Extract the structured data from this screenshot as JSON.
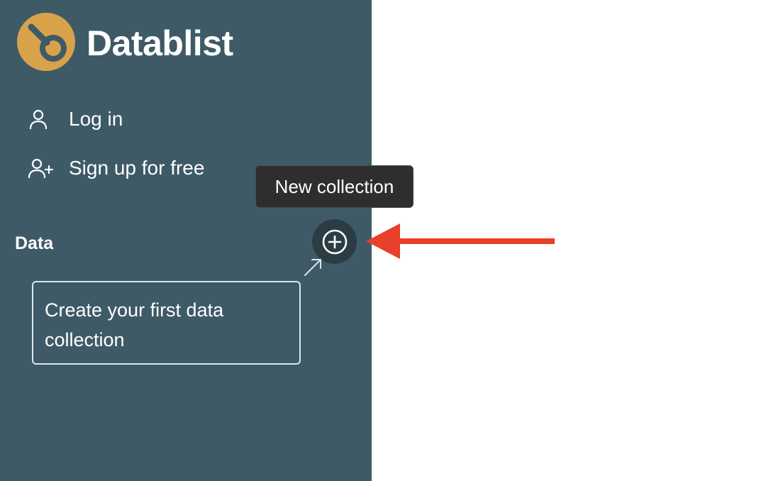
{
  "app": {
    "brand_name": "Datablist",
    "logo_icon": "datablist-logo-icon",
    "logo_color": "#d8a24a"
  },
  "sidebar": {
    "background": "#3e5a66",
    "nav": [
      {
        "label": "Log in",
        "icon": "user-icon"
      },
      {
        "label": "Sign up for free",
        "icon": "user-plus-icon"
      }
    ],
    "data_section": {
      "title": "Data",
      "add_button_icon": "plus-circle-icon",
      "empty_hint": "Create your first data collection"
    }
  },
  "tooltip": {
    "text": "New collection"
  },
  "annotation": {
    "arrow_color": "#e8402a"
  }
}
